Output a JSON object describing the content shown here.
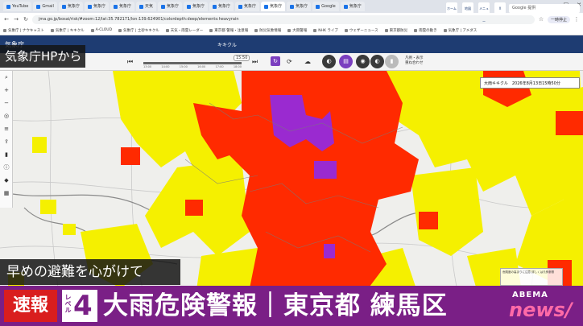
{
  "browser": {
    "tabs": [
      {
        "label": "YouTube",
        "active": false
      },
      {
        "label": "Gmail",
        "active": false
      },
      {
        "label": "気象庁",
        "active": false
      },
      {
        "label": "気象庁",
        "active": false
      },
      {
        "label": "気象庁",
        "active": false
      },
      {
        "label": "天気",
        "active": false
      },
      {
        "label": "気象庁",
        "active": false
      },
      {
        "label": "気象庁",
        "active": false
      },
      {
        "label": "気象庁",
        "active": false
      },
      {
        "label": "気象庁",
        "active": false
      },
      {
        "label": "気象庁",
        "active": true
      },
      {
        "label": "気象庁",
        "active": false
      },
      {
        "label": "Google",
        "active": false
      },
      {
        "label": "気象庁",
        "active": false
      }
    ],
    "url": "jma.go.jp/bosai/risk/#zoom:12/lat:35.782171/lon:139.624901/colordepth:deep/elements:heavyrain",
    "profile_label": "一時停止",
    "bookmarks": [
      "気象庁 | ナウキャスト",
      "気象庁 | キキクル",
      "A-CLOUD",
      "気象庁 | 土砂キキクル",
      "天気・雨雲レーダー",
      "東京都 警報・注意報",
      "防災気象情報",
      "大雨警報",
      "NHK ライブ",
      "ウェザーニュース",
      "東京都防災",
      "雨雲の動き",
      "気象庁 | アメダス"
    ]
  },
  "jma": {
    "logo": "気象庁",
    "page_title": "キキクル",
    "header_icons": [
      "ホーム",
      "地図",
      "メニュー",
      "X"
    ],
    "search_placeholder": "Google 提供"
  },
  "toolbar": {
    "time_pill": "15:50",
    "ticks": [
      "13:00",
      "14:00",
      "15:00",
      "16:00",
      "17:00",
      "18:00"
    ],
    "progress_fraction": 1.0,
    "label_line1": "凡例・表示",
    "label_line2": "重ね合わせ"
  },
  "map": {
    "info_box": "大雨キキクル　2026年8月13日15時50分",
    "legend_text": "危険度の高まりに注意 詳しくは凡例参照"
  },
  "overlays": {
    "source_tag": "気象庁HPから",
    "advice": "早めの避難を心がけて"
  },
  "ticker": {
    "breaking": "速報",
    "level_label": "レベル",
    "level_number": "4",
    "headline": "大雨危険警報｜東京都 練馬区"
  },
  "branding": {
    "abema_top": "ABEMA",
    "abema_bottom": "news/"
  },
  "colors": {
    "warning_red": "#ff2a00",
    "warning_yellow": "#f5f000",
    "emergency_purple": "#9a2ad0",
    "ticker_purple": "#7a1f86",
    "breaking_red": "#d91e1e"
  }
}
